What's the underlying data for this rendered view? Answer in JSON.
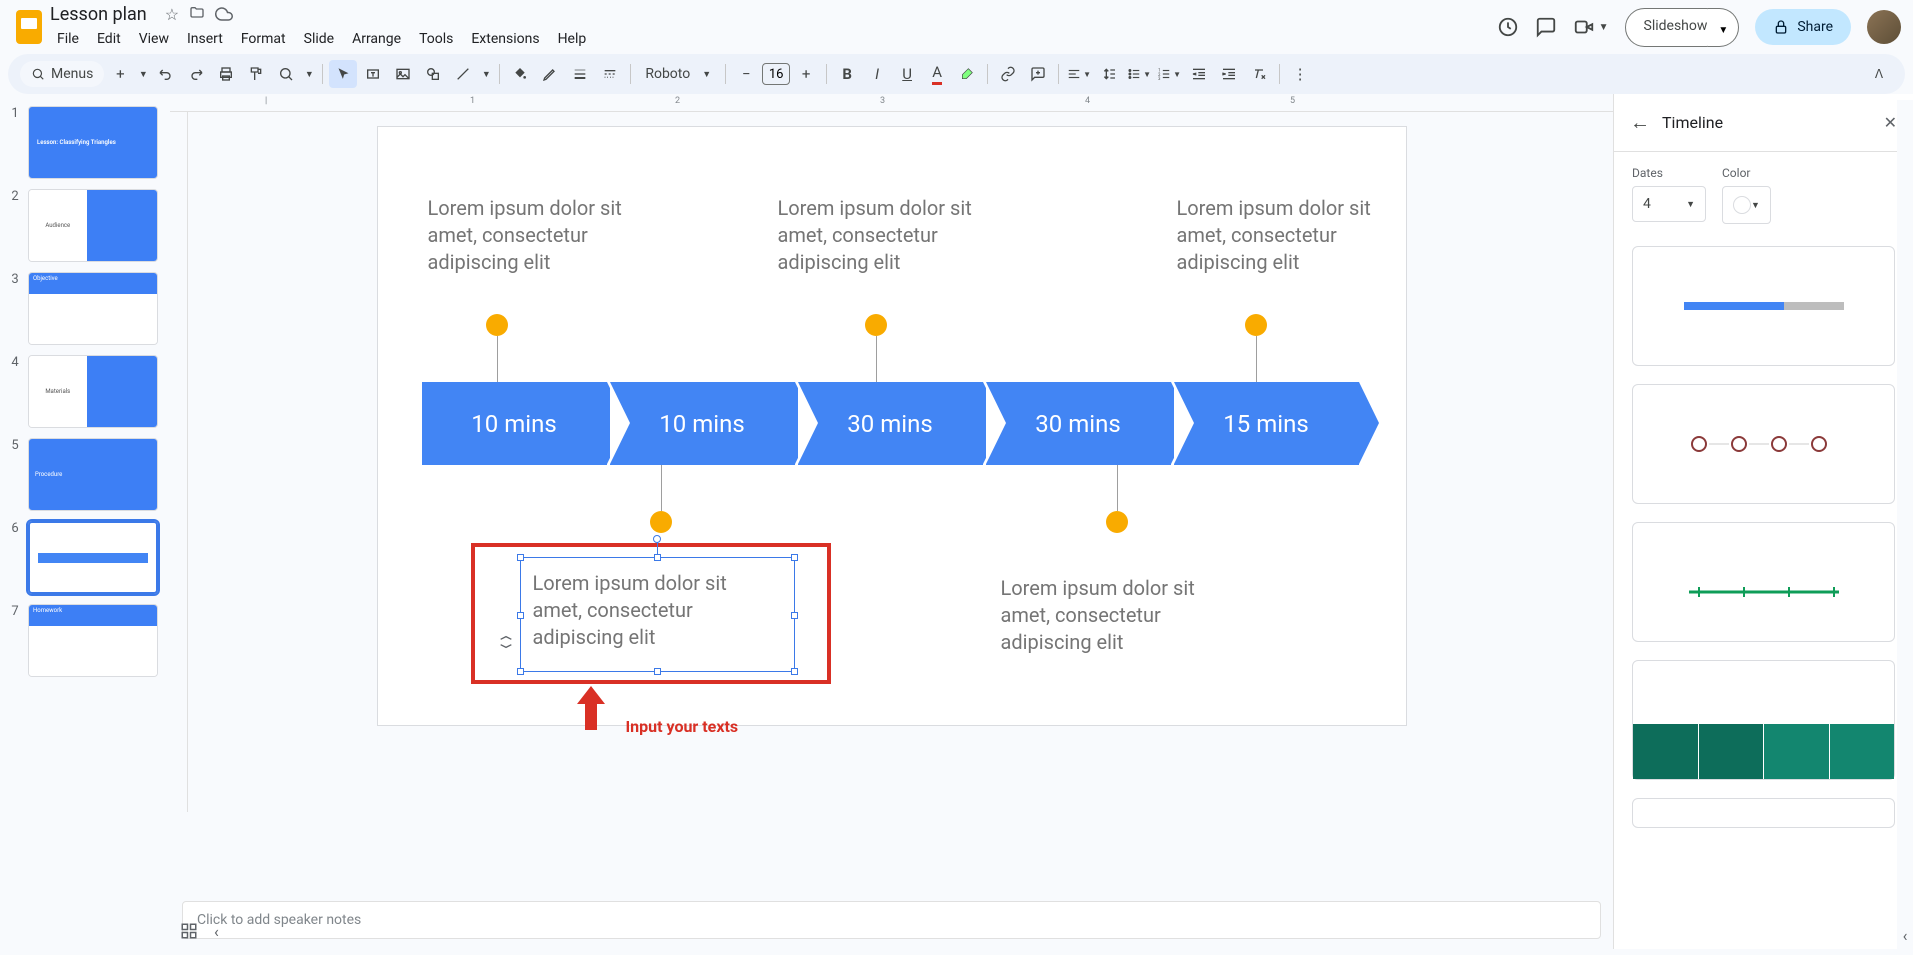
{
  "header": {
    "title": "Lesson plan",
    "slideshow": "Slideshow",
    "share": "Share"
  },
  "menus": [
    "File",
    "Edit",
    "View",
    "Insert",
    "Format",
    "Slide",
    "Arrange",
    "Tools",
    "Extensions",
    "Help"
  ],
  "toolbar": {
    "menus_label": "Menus",
    "font_family": "Roboto",
    "font_size": "16"
  },
  "slides": {
    "count": 7,
    "current": 6
  },
  "canvas": {
    "lorem": "Lorem ipsum dolor sit amet, consectetur adipiscing elit",
    "durations": [
      "10 mins",
      "10 mins",
      "30 mins",
      "30 mins",
      "15 mins"
    ],
    "callout": "Input your texts"
  },
  "speaker_notes": {
    "placeholder": "Click to add speaker notes"
  },
  "side_panel": {
    "title": "Timeline",
    "dates_label": "Dates",
    "dates_value": "4",
    "color_label": "Color"
  },
  "thumbnails": {
    "t1_title": "Lesson: Classifying Triangles",
    "t2_title": "Audience",
    "t3_title": "Objective",
    "t4_title": "Materials",
    "t5_title": "Procedure",
    "t7_title": "Homework"
  }
}
